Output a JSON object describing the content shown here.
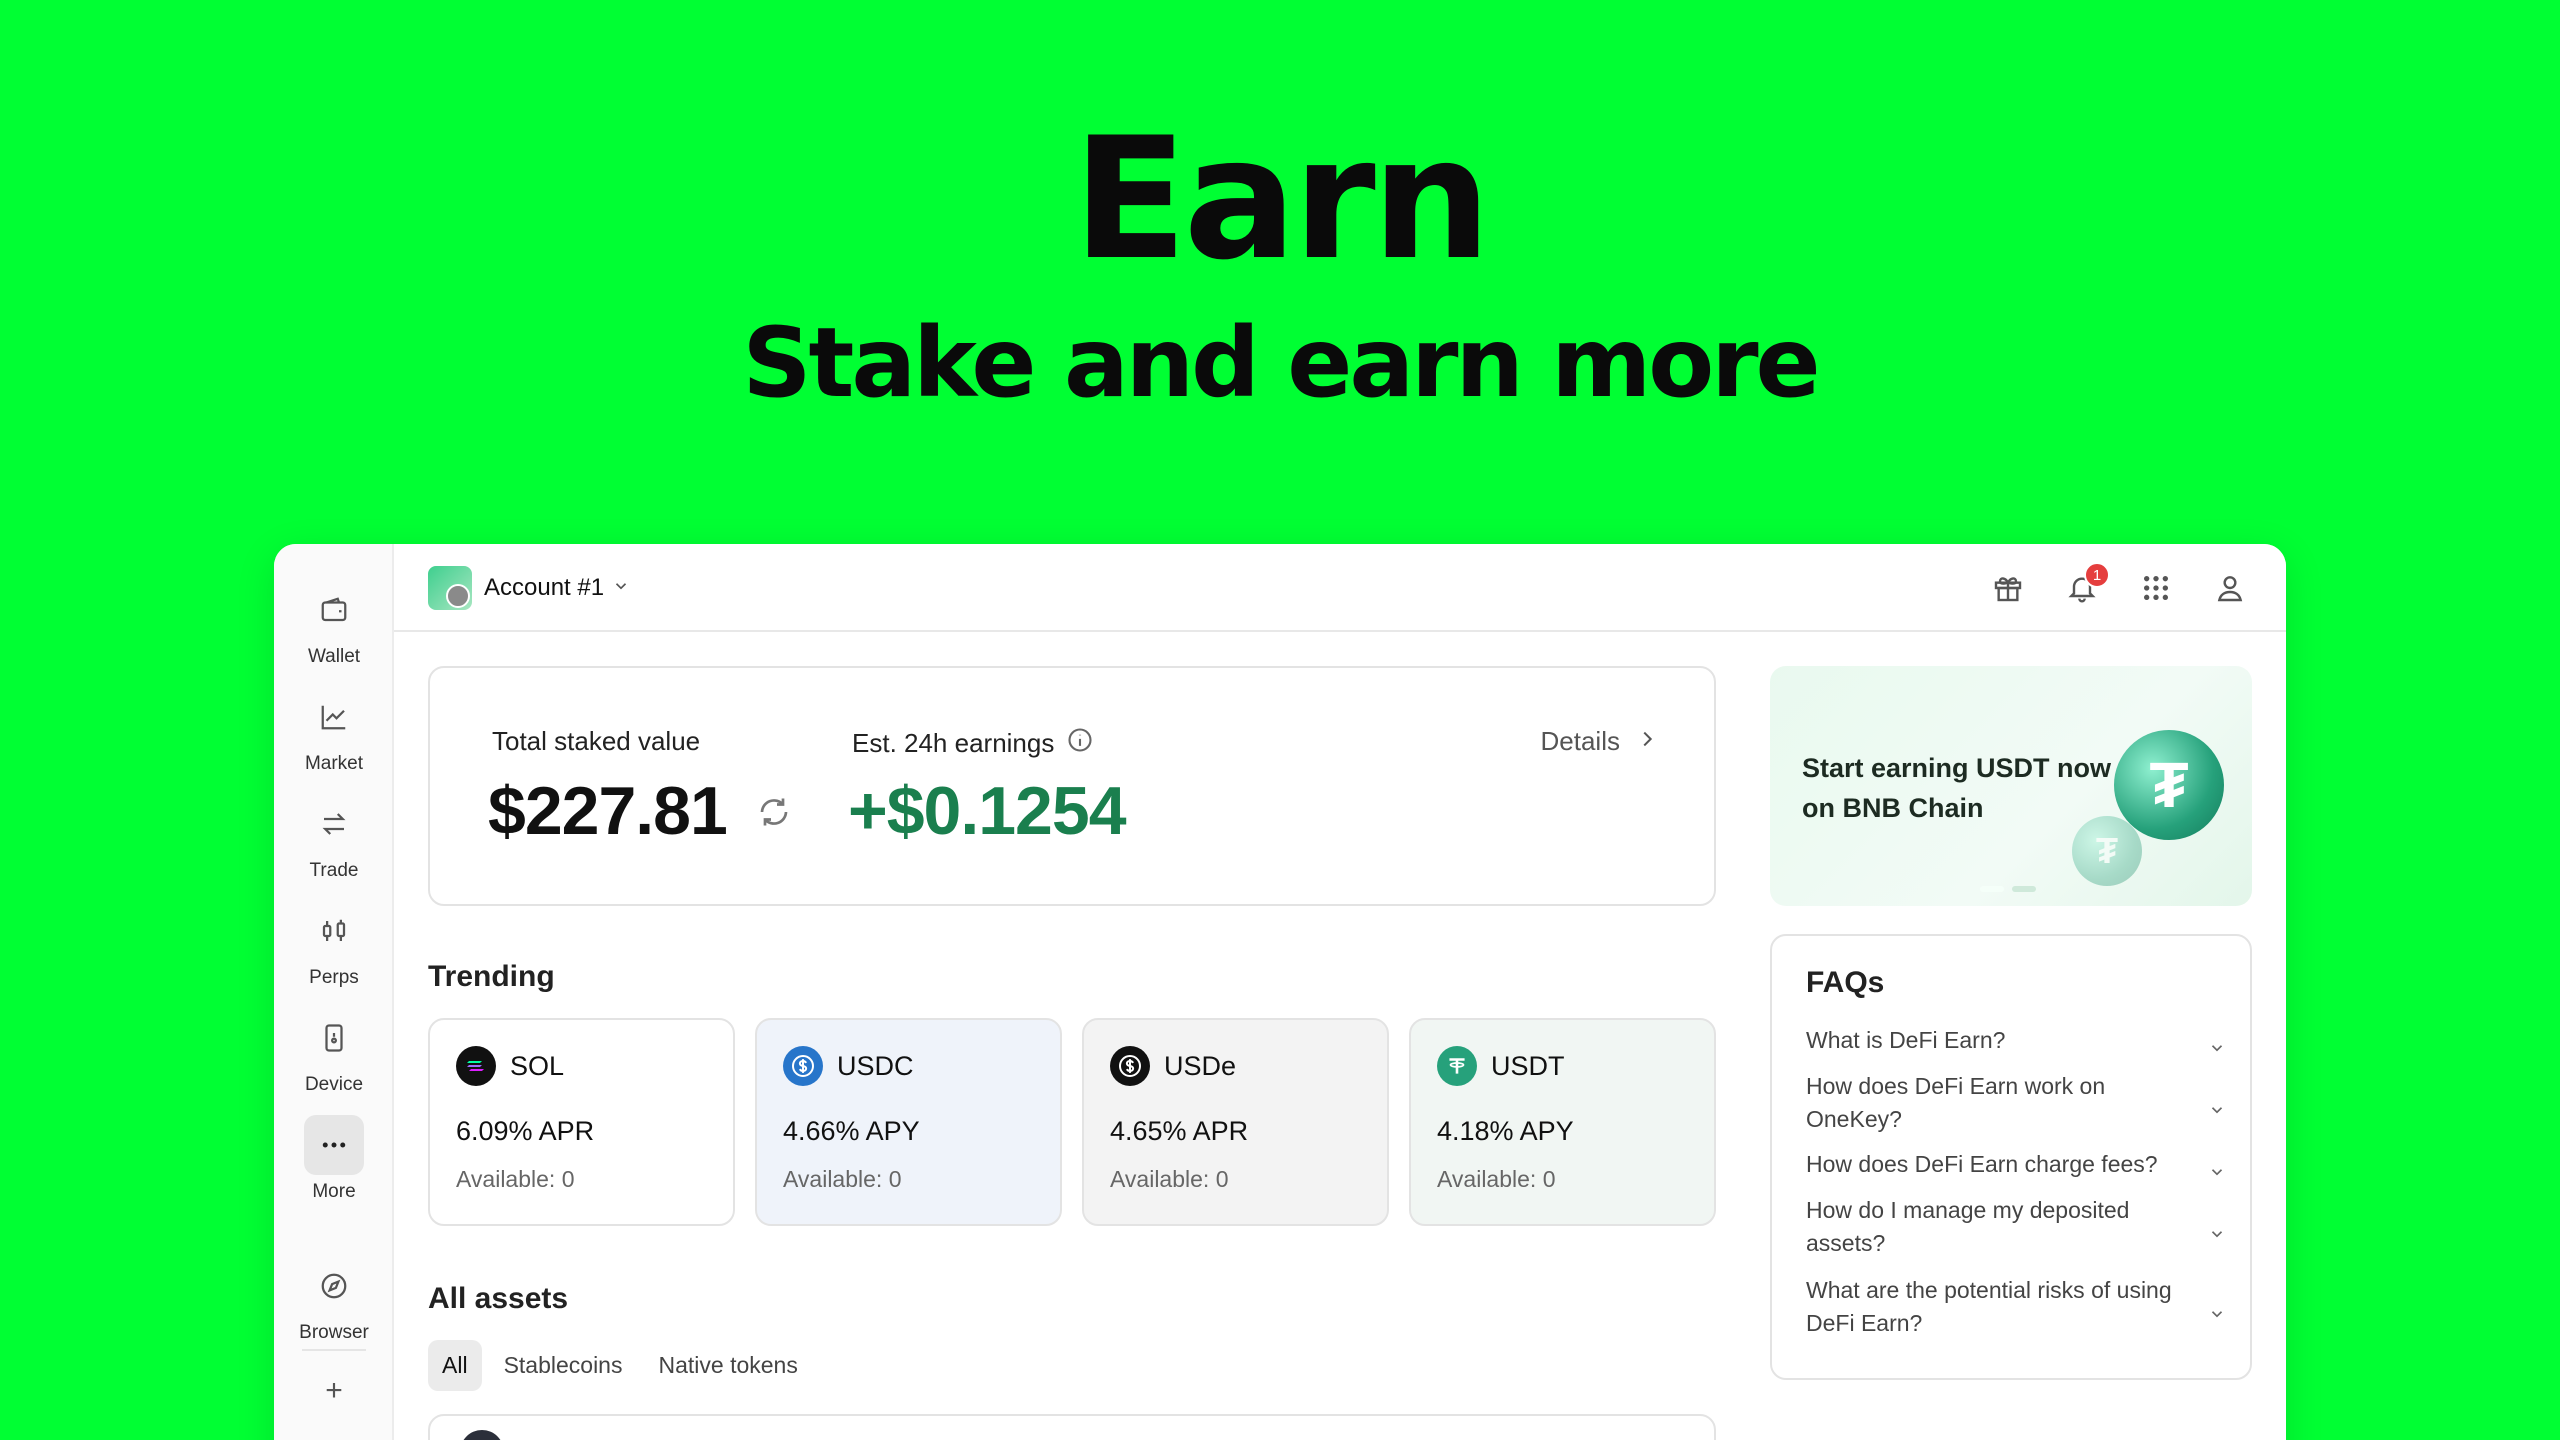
{
  "hero": {
    "title": "Earn",
    "subtitle": "Stake and earn more"
  },
  "sidebar": {
    "items": [
      {
        "label": "Wallet",
        "icon": "wallet-icon"
      },
      {
        "label": "Market",
        "icon": "chart-icon"
      },
      {
        "label": "Trade",
        "icon": "swap-icon"
      },
      {
        "label": "Perps",
        "icon": "candles-icon"
      },
      {
        "label": "Device",
        "icon": "device-icon"
      },
      {
        "label": "More",
        "icon": "more-icon"
      },
      {
        "label": "Browser",
        "icon": "compass-icon"
      }
    ],
    "add": "+"
  },
  "topbar": {
    "account": "Account #1",
    "notification_count": "1"
  },
  "staked": {
    "total_label": "Total staked value",
    "total_value": "$227.81",
    "earn_label": "Est. 24h earnings",
    "earn_value": "+$0.1254",
    "details": "Details"
  },
  "trending": {
    "title": "Trending",
    "items": [
      {
        "name": "SOL",
        "rate": "6.09% APR",
        "available": "Available: 0"
      },
      {
        "name": "USDC",
        "rate": "4.66% APY",
        "available": "Available: 0"
      },
      {
        "name": "USDe",
        "rate": "4.65% APR",
        "available": "Available: 0"
      },
      {
        "name": "USDT",
        "rate": "4.18% APY",
        "available": "Available: 0"
      }
    ]
  },
  "assets": {
    "title": "All assets",
    "tabs": [
      "All",
      "Stablecoins",
      "Native tokens"
    ]
  },
  "promo": {
    "text": "Start earning USDT now on BNB Chain"
  },
  "faq": {
    "title": "FAQs",
    "items": [
      "What is DeFi Earn?",
      "How does DeFi Earn work on OneKey?",
      "How does DeFi Earn charge fees?",
      "How do I manage my deposited assets?",
      "What are the potential risks of using DeFi Earn?"
    ]
  },
  "colors": {
    "background": "#00ff33",
    "earn_green": "#1a7f4e",
    "usdc_blue": "#2775ca",
    "usdt_green": "#26a17b"
  }
}
